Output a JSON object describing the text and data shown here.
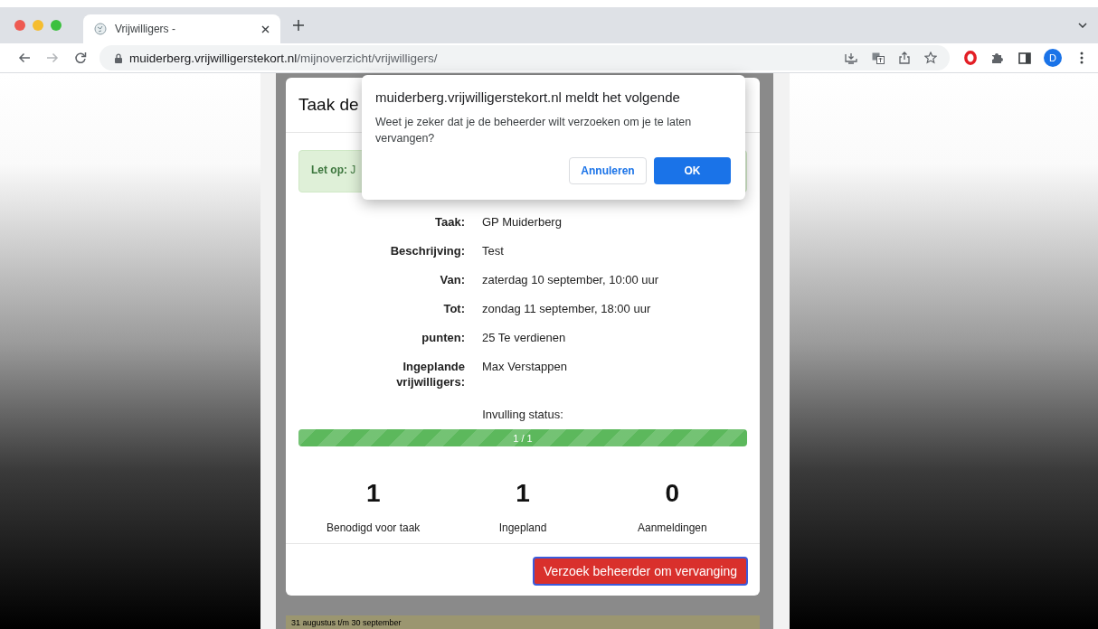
{
  "browser": {
    "tabs": [
      {
        "title": "Vrijwilligers -",
        "selected": true
      }
    ],
    "nav": [
      {
        "kind": "back",
        "disabled": false
      },
      {
        "kind": "forward",
        "disabled": true
      },
      {
        "kind": "reload",
        "disabled": false
      }
    ],
    "url": {
      "host": "muiderberg.vrijwilligerstekort.nl",
      "path": "/mijnoverzicht/vrijwilligers/"
    },
    "avatar": "D"
  },
  "modal": {
    "title": "Taak de",
    "notice": "**Let op:** J",
    "details": [
      {
        "label": "Taak:",
        "value": "GP Muiderberg"
      },
      {
        "label": "Beschrijving:",
        "value": "Test"
      },
      {
        "label": "Van:",
        "value": "zaterdag 10 september, 10:00 uur"
      },
      {
        "label": "Tot:",
        "value": "zondag 11 september, 18:00 uur"
      },
      {
        "label": "punten:",
        "value": "25 Te verdienen"
      },
      {
        "label": "Ingeplande vrijwilligers:",
        "value": "Max Verstappen"
      }
    ],
    "status_label": "Invulling status:",
    "progress": {
      "level": 1,
      "text": "1 / 1"
    },
    "stats": [
      {
        "value": "1",
        "label": "Benodigd voor taak"
      },
      {
        "value": "1",
        "label": "Ingepland"
      },
      {
        "value": "0",
        "label": "Aanmeldingen"
      }
    ],
    "action": "Verzoek beheerder om vervanging"
  },
  "page": {
    "footer_text": "31 augustus t/m 30 september"
  },
  "dialog": {
    "title": "muiderberg.vrijwilligerstekort.nl meldt het volgende",
    "message": "Weet je zeker dat je de beheerder wilt verzoeken om je te laten vervangen?",
    "buttons": [
      {
        "label": "Annuleren",
        "kind": "secondary"
      },
      {
        "label": "OK",
        "kind": "primary"
      }
    ]
  }
}
